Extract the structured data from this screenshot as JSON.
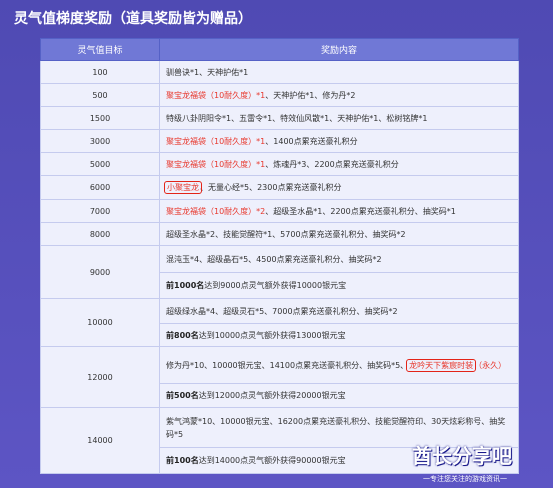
{
  "page_title": "灵气值梯度奖励（道具奖励皆为赠品）",
  "table": {
    "col_target": "灵气值目标",
    "col_reward": "奖励内容",
    "rows": [
      {
        "target": "100",
        "segs": [
          {
            "t": "驯兽诀*1、天神护佑*1",
            "s": "n"
          }
        ]
      },
      {
        "target": "500",
        "segs": [
          {
            "t": "聚宝龙福袋（10耐久度）*1",
            "s": "hl"
          },
          {
            "t": "、天神护佑*1、修为丹*2",
            "s": "n"
          }
        ]
      },
      {
        "target": "1500",
        "segs": [
          {
            "t": "特级八卦阴阳令*1、五雷令*1、特效仙风散*1、天神护佑*1、松树铭牌*1",
            "s": "n"
          }
        ]
      },
      {
        "target": "3000",
        "segs": [
          {
            "t": "聚宝龙福袋（10耐久度）*1",
            "s": "hl"
          },
          {
            "t": "、1400点累充送豪礼积分",
            "s": "n"
          }
        ]
      },
      {
        "target": "5000",
        "segs": [
          {
            "t": "聚宝龙福袋（10耐久度）*1",
            "s": "hl"
          },
          {
            "t": "、炼魂丹*3、2200点累充送豪礼积分",
            "s": "n"
          }
        ]
      },
      {
        "target": "6000",
        "segs": [
          {
            "t": "小聚宝龙",
            "s": "boxhl"
          },
          {
            "t": "、无量心经*5、2300点累充送豪礼积分",
            "s": "n"
          }
        ]
      },
      {
        "target": "7000",
        "segs": [
          {
            "t": "聚宝龙福袋（10耐久度）*2",
            "s": "hl"
          },
          {
            "t": "、超级圣水晶*1、2200点累充送豪礼积分、抽奖码*1",
            "s": "n"
          }
        ]
      },
      {
        "target": "8000",
        "segs": [
          {
            "t": "超级圣水晶*2、技能觉醒符*1、5700点累充送豪礼积分、抽奖码*2",
            "s": "n"
          }
        ]
      },
      {
        "target": "9000",
        "sub": [
          [
            {
              "t": "混沌玉*4、超级晶石*5、4500点累充送豪礼积分、抽奖码*2",
              "s": "n"
            }
          ],
          [
            {
              "t": "前1000名",
              "s": "b"
            },
            {
              "t": "达到9000点灵气额外获得10000银元宝",
              "s": "n"
            }
          ]
        ]
      },
      {
        "target": "10000",
        "sub": [
          [
            {
              "t": "超级绿水晶*4、超级灵石*5、7000点累充送豪礼积分、抽奖码*2",
              "s": "n"
            }
          ],
          [
            {
              "t": "前800名",
              "s": "b"
            },
            {
              "t": "达到10000点灵气额外获得13000银元宝",
              "s": "n"
            }
          ]
        ]
      },
      {
        "target": "12000",
        "sub": [
          [
            {
              "t": "修为丹*10、10000银元宝、14100点累充送豪礼积分、抽奖码*5、",
              "s": "n"
            },
            {
              "t": "龙吟天下紫宸时装",
              "s": "boxhl"
            },
            {
              "t": "（永久）",
              "s": "hl"
            }
          ],
          [
            {
              "t": "前500名",
              "s": "b"
            },
            {
              "t": "达到12000点灵气额外获得20000银元宝",
              "s": "n"
            }
          ]
        ]
      },
      {
        "target": "14000",
        "sub": [
          [
            {
              "t": "紫气鸿蒙*10、10000银元宝、16200点累充送豪礼积分、技能觉醒符印、30天炫彩称号、抽奖码*5",
              "s": "n"
            }
          ],
          [
            {
              "t": "前100名",
              "s": "b"
            },
            {
              "t": "达到14000点灵气额外获得90000银元宝",
              "s": "n"
            }
          ]
        ]
      }
    ]
  },
  "watermark": {
    "main": "酋长分享吧",
    "sub": "一专注您关注的游戏资讯一"
  }
}
